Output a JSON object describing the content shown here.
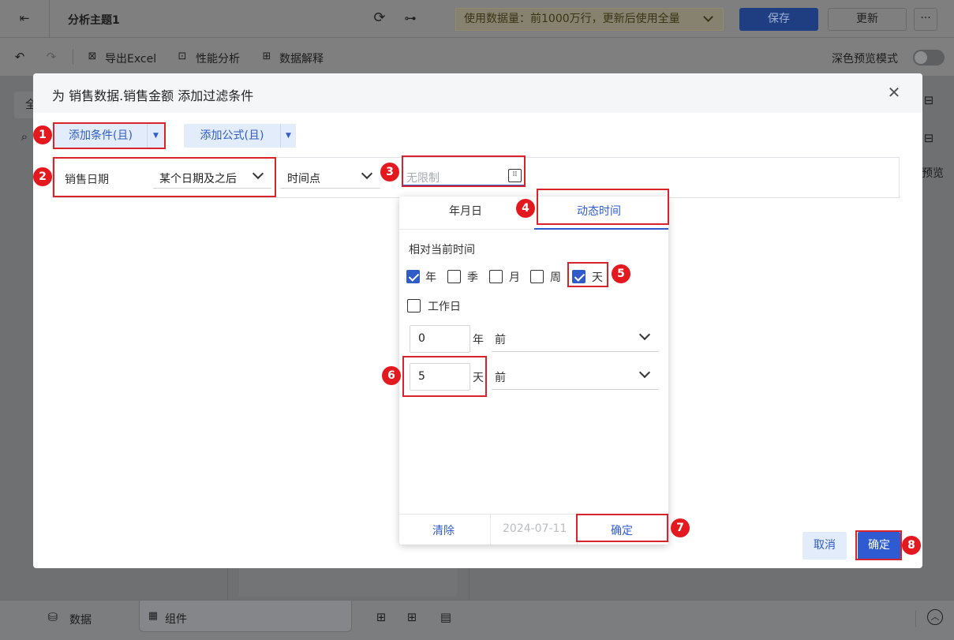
{
  "header": {
    "back_icon": "exit-icon",
    "title": "分析主题1",
    "refresh_icon": "refresh-icon",
    "flow_icon": "flow-icon",
    "data_usage": "使用数据量：前1000万行，更新后使用全量",
    "save": "保存",
    "update": "更新",
    "more": "···"
  },
  "toolbar": {
    "export_excel": "导出Excel",
    "perf_analysis": "性能分析",
    "data_explain": "数据解释",
    "dark_preview": "深色预览模式"
  },
  "background": {
    "side_tab": "全",
    "side_preview": "预览"
  },
  "modal": {
    "title": "为 销售数据.销售金额 添加过滤条件",
    "add_condition": "添加条件(且)",
    "add_formula": "添加公式(且)",
    "field_name": "销售日期",
    "operator": "某个日期及之后",
    "time_mode": "时间点",
    "date_placeholder": "无限制",
    "cancel": "取消",
    "confirm": "确定"
  },
  "popup": {
    "tab_date": "年月日",
    "tab_dynamic": "动态时间",
    "relative_label": "相对当前时间",
    "units": [
      {
        "label": "年",
        "checked": true
      },
      {
        "label": "季",
        "checked": false
      },
      {
        "label": "月",
        "checked": false
      },
      {
        "label": "周",
        "checked": false
      },
      {
        "label": "天",
        "checked": true
      }
    ],
    "workday": "工作日",
    "year_value": "0",
    "year_unit": "年",
    "year_dir": "前",
    "day_value": "5",
    "day_unit": "天",
    "day_dir": "前",
    "clear": "清除",
    "date_preview": "2024-07-11",
    "ok": "确定"
  },
  "bottom": {
    "data_tab": "数据",
    "component_tab": "组件"
  },
  "steps": [
    "1",
    "2",
    "3",
    "4",
    "5",
    "6",
    "7",
    "8"
  ],
  "colors": {
    "accent": "#2e5bd1",
    "highlight_red": "#d8232a",
    "badge_red": "#e3191f"
  }
}
